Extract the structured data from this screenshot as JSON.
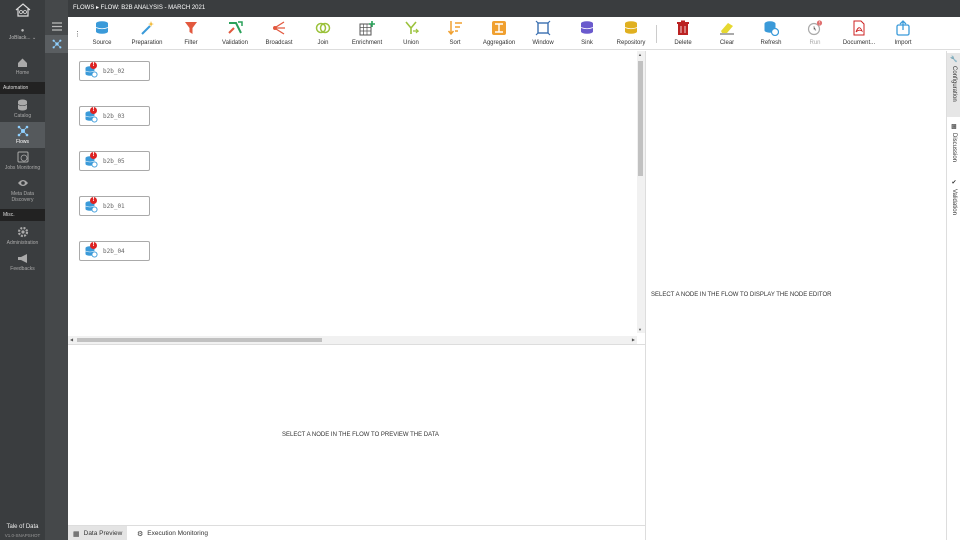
{
  "app": {
    "brand": "Tale of Data",
    "version": "V1.0-SNAPSHOT",
    "user": "JoBlack..."
  },
  "breadcrumb": "FLOWS ▸ FLOW: B2B ANALYSIS - MARCH 2021",
  "nav": {
    "home": "Home",
    "section_automation": "Automation",
    "catalog": "Catalog",
    "flows": "Flows",
    "jobs": "Jobs Monitoring",
    "metadata": "Meta Data Discovery",
    "section_misc": "Misc.",
    "administration": "Administration",
    "feedbacks": "Feedbacks"
  },
  "toolbar": {
    "source": "Source",
    "preparation": "Preparation",
    "filter": "Filter",
    "validation": "Validation",
    "broadcast": "Broadcast",
    "join": "Join",
    "enrichment": "Enrichment",
    "union": "Union",
    "sort": "Sort",
    "aggregation": "Aggregation",
    "window": "Window",
    "sink": "Sink",
    "repository": "Repository",
    "delete": "Delete",
    "clear": "Clear",
    "refresh": "Refresh",
    "run": "Run",
    "document": "Document...",
    "import": "Import"
  },
  "nodes": [
    {
      "label": "b2b_02"
    },
    {
      "label": "b2b_03"
    },
    {
      "label": "b2b_05"
    },
    {
      "label": "b2b_01"
    },
    {
      "label": "b2b_04"
    }
  ],
  "node_error_badge": "!",
  "messages": {
    "preview": "SELECT A NODE IN THE FLOW TO PREVIEW THE DATA",
    "editor": "SELECT A NODE IN THE FLOW TO DISPLAY THE NODE EDITOR"
  },
  "bottom_tabs": {
    "data_preview": "Data Preview",
    "execution_monitoring": "Execution Monitoring"
  },
  "right_tabs": {
    "configuration": "Configuration",
    "discussion": "Discussion",
    "validation": "Validation"
  },
  "colors": {
    "nav_bg": "#3a3d3f",
    "error": "#dd2222",
    "source_blue": "#3a9ad9"
  }
}
